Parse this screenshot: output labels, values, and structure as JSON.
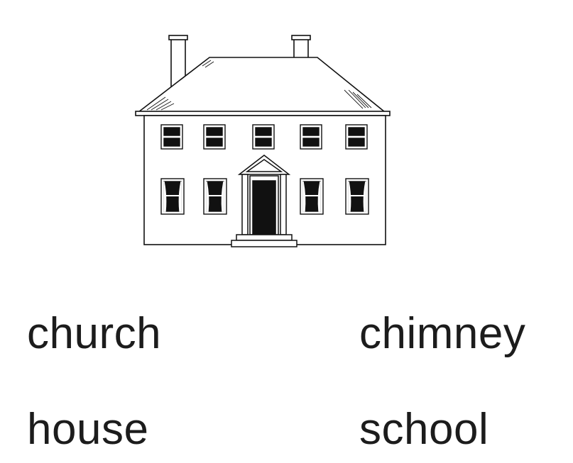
{
  "illustration": {
    "subject": "house",
    "icon": "house-drawing",
    "stroke_color": "#111111",
    "fill_color": "#ffffff"
  },
  "words": {
    "w1": "church",
    "w2": "chimney",
    "w3": "house",
    "w4": "school"
  }
}
